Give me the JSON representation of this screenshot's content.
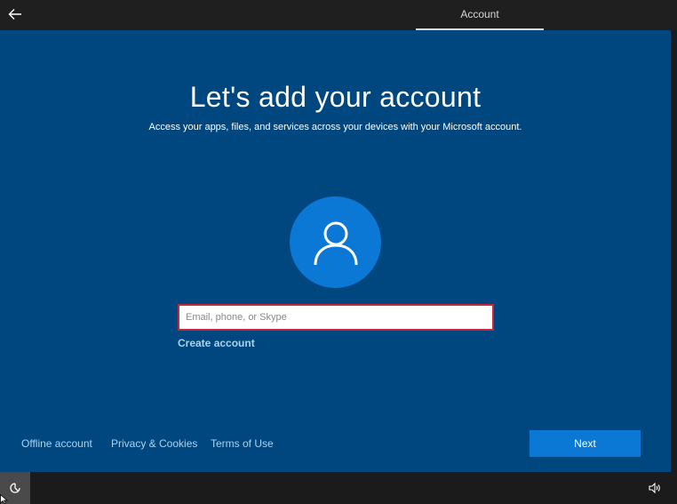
{
  "header": {
    "tab_label": "Account"
  },
  "main": {
    "title": "Let's add your account",
    "subtitle": "Access your apps, files, and services across your devices with your Microsoft account.",
    "email_placeholder": "Email, phone, or Skype",
    "create_account_label": "Create account"
  },
  "footer": {
    "offline_label": "Offline account",
    "privacy_label": "Privacy & Cookies",
    "terms_label": "Terms of Use",
    "next_label": "Next"
  },
  "icons": {
    "back": "arrow-left-icon",
    "avatar": "user-icon",
    "ease_of_access": "ease-of-access-icon",
    "volume": "volume-icon"
  },
  "colors": {
    "panel": "#00477f",
    "accent": "#0a78d4",
    "link": "#a8d3f5",
    "input_border": "#c4283c"
  }
}
